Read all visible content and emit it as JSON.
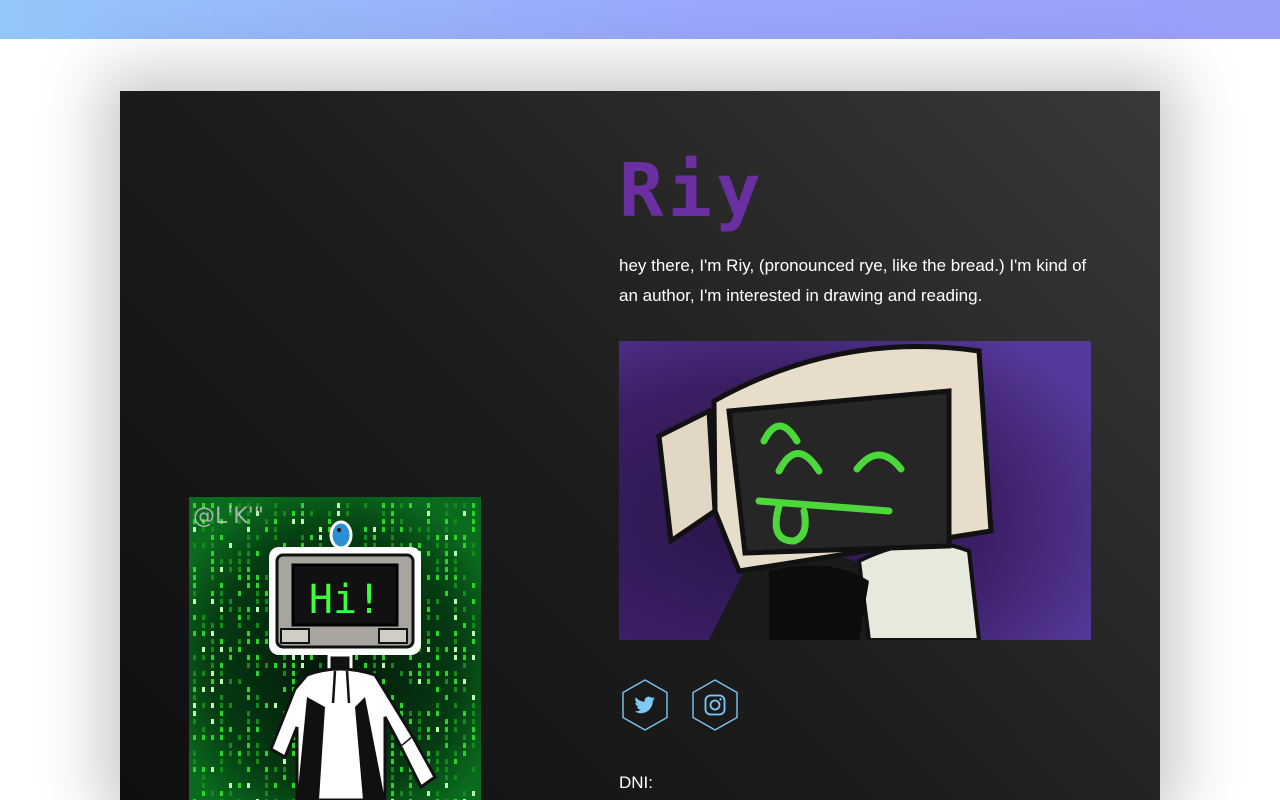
{
  "profile": {
    "name": "Riy",
    "bio": "hey there, I'm Riy, (pronounced rye, like the bread.) I'm kind of an author, I'm interested in drawing and reading.",
    "dni_label": "DNI:"
  },
  "left_art": {
    "speech_text": "Hi!",
    "watermark": "@L'K'\""
  },
  "social": [
    {
      "name": "twitter",
      "icon": "twitter-icon"
    },
    {
      "name": "instagram",
      "icon": "instagram-icon"
    }
  ],
  "colors": {
    "topbar_start": "#95c6fb",
    "topbar_end": "#9a9ff8",
    "title_purple": "#6a2fa0",
    "icon_blue": "#7ec8f5",
    "card_dark": "#1c1c1c",
    "matrix_green": "#2bd42b"
  }
}
